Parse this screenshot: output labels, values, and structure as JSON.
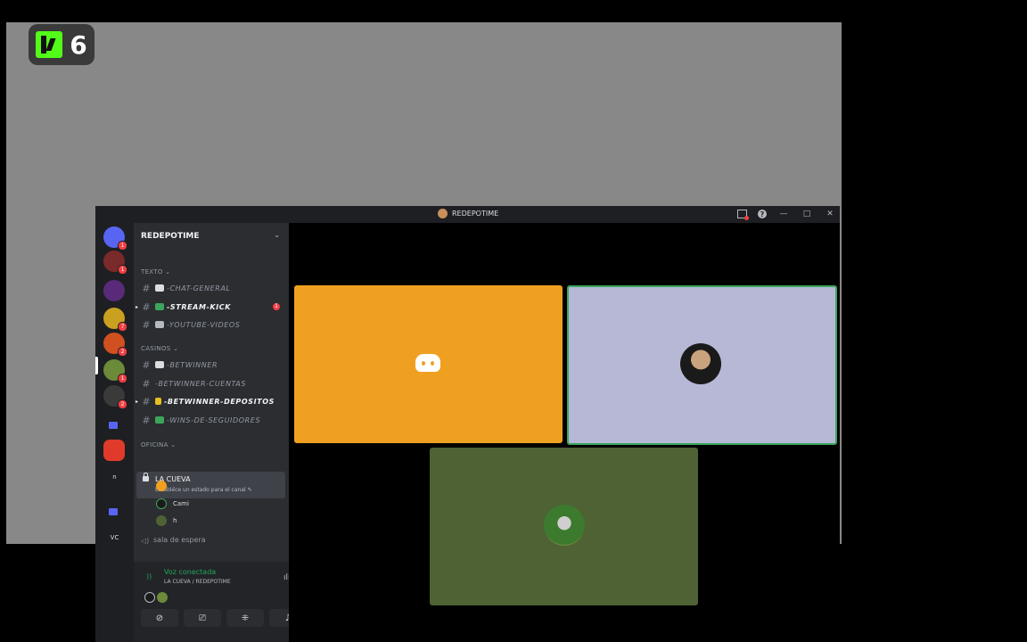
{
  "overlay": {
    "kick_count": "6"
  },
  "window": {
    "title": "REDEPOTIME",
    "controls": {
      "help": "?",
      "minimize": "—",
      "maximize": "□",
      "close": "✕"
    }
  },
  "guilds": [
    {
      "name": "home",
      "badge": "1"
    },
    {
      "name": "server-2",
      "badge": "1"
    },
    {
      "name": "server-3",
      "badge": "7"
    },
    {
      "name": "server-4",
      "badge": "2"
    },
    {
      "name": "server-5",
      "badge": "1"
    },
    {
      "name": "server-6",
      "badge": "2"
    },
    {
      "name": "folder-1"
    },
    {
      "name": "server-7"
    },
    {
      "name": "server-8",
      "label": "n"
    },
    {
      "name": "folder-2"
    },
    {
      "name": "server-9",
      "label": "VC"
    }
  ],
  "server": {
    "name": "REDEPOTIME",
    "categories": {
      "texto": "TEXTO ⌄",
      "casinos": "CASINOS ⌄",
      "oficina": "OFICINA ⌄"
    },
    "text_channels": [
      {
        "name": "-CHAT-GENERAL"
      },
      {
        "name": "-STREAM-KICK",
        "unread": true,
        "mentions": "1"
      },
      {
        "name": "-YOUTUBE-VIDEOS"
      }
    ],
    "casino_channels": [
      {
        "name": "-BETWINNER"
      },
      {
        "name": "-BETWINNER-CUENTAS"
      },
      {
        "name": "-BETWINNER-DEPOSITOS",
        "unread": true
      },
      {
        "name": "-WINS-DE-SEGUIDORES"
      }
    ],
    "voice_channel": {
      "name": "LA CUEVA",
      "status": "Establece un estado para el canal ✎",
      "users": [
        {
          "name": "."
        },
        {
          "name": "Cami"
        },
        {
          "name": "h"
        }
      ]
    },
    "waiting_room": "sala de espera"
  },
  "voice_panel": {
    "title": "Voz conectada",
    "subtitle": "LA CUEVA / REDEPOTIME"
  },
  "tiles": [
    {
      "name": "discord-default-avatar"
    },
    {
      "name": "user-avatar-woman"
    },
    {
      "name": "user-avatar-soccer"
    }
  ],
  "colors": {
    "accent_green": "#23a55a",
    "kick_green": "#53fc18",
    "tile_orange": "#f0a020",
    "tile_lavender": "#b6b8d6",
    "tile_olive": "#4f6233"
  }
}
